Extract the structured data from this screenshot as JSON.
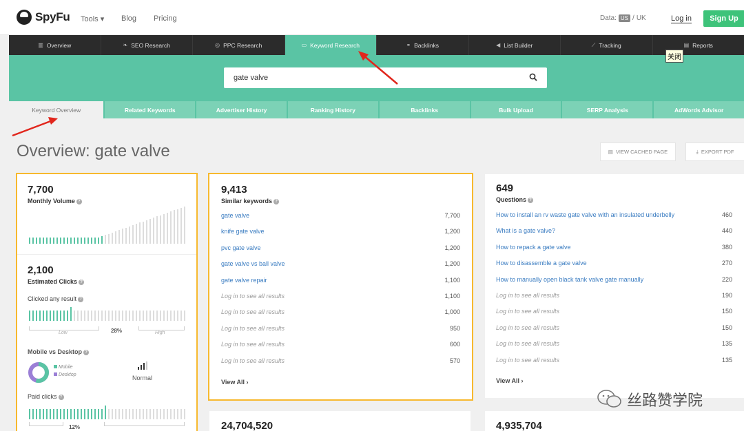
{
  "brand": {
    "name": "SpyFu"
  },
  "topnav": {
    "tools": "Tools ▾",
    "blog": "Blog",
    "pricing": "Pricing",
    "data_label": "Data:",
    "data_us": "US",
    "data_sep": "/",
    "data_uk": "UK",
    "login": "Log in",
    "signup": "Sign Up"
  },
  "mainnav": [
    {
      "label": "Overview",
      "icon": "bar-chart-icon",
      "glyph": "▥"
    },
    {
      "label": "SEO Research",
      "icon": "leaf-icon",
      "glyph": "❧"
    },
    {
      "label": "PPC Research",
      "icon": "target-icon",
      "glyph": "◎"
    },
    {
      "label": "Keyword Research",
      "icon": "keyboard-icon",
      "glyph": "▭"
    },
    {
      "label": "Backlinks",
      "icon": "link-icon",
      "glyph": "⚭"
    },
    {
      "label": "List Builder",
      "icon": "megaphone-icon",
      "glyph": "◀"
    },
    {
      "label": "Tracking",
      "icon": "line-chart-icon",
      "glyph": "⟋"
    },
    {
      "label": "Reports",
      "icon": "document-icon",
      "glyph": "▤"
    }
  ],
  "tooltip": "关闭",
  "search": {
    "value": "gate valve"
  },
  "subtabs": [
    "Keyword Overview",
    "Related Keywords",
    "Advertiser History",
    "Ranking History",
    "Backlinks",
    "Bulk Upload",
    "SERP Analysis",
    "AdWords Advisor"
  ],
  "page": {
    "title": "Overview: gate valve",
    "view_cached": "VIEW CACHED PAGE",
    "export_pdf": "EXPORT PDF"
  },
  "left": {
    "volume": "7,700",
    "volume_label": "Monthly Volume",
    "clicks": "2,100",
    "clicks_label": "Estimated Clicks",
    "clicked_any": "Clicked any result",
    "clicked_pct": "28%",
    "low": "Low",
    "high": "High",
    "mvd": "Mobile vs Desktop",
    "mobile": "Mobile",
    "desktop": "Desktop",
    "normal": "Normal",
    "paid": "Paid clicks",
    "paid_pct": "12%",
    "colors": {
      "mobile": "#5ac4a4",
      "desktop": "#9b7fd6"
    }
  },
  "similar": {
    "count": "9,413",
    "label": "Similar keywords",
    "view_all": "View All",
    "rows": [
      {
        "k": "gate valve",
        "v": "7,700"
      },
      {
        "k": "knife gate valve",
        "v": "1,200"
      },
      {
        "k": "pvc gate valve",
        "v": "1,200"
      },
      {
        "k": "gate valve vs ball valve",
        "v": "1,200"
      },
      {
        "k": "gate valve repair",
        "v": "1,100"
      },
      {
        "k": "Log in to see all results",
        "v": "1,100"
      },
      {
        "k": "Log in to see all results",
        "v": "1,000"
      },
      {
        "k": "Log in to see all results",
        "v": "950"
      },
      {
        "k": "Log in to see all results",
        "v": "600"
      },
      {
        "k": "Log in to see all results",
        "v": "570"
      }
    ]
  },
  "questions": {
    "count": "649",
    "label": "Questions",
    "view_all": "View All",
    "rows": [
      {
        "k": "How to install an rv waste gate valve with an insulated underbelly",
        "v": "460"
      },
      {
        "k": "What is a gate valve?",
        "v": "440"
      },
      {
        "k": "How to repack a gate valve",
        "v": "380"
      },
      {
        "k": "How to disassemble a gate valve",
        "v": "270"
      },
      {
        "k": "How to manually open black tank valve gate manually",
        "v": "220"
      },
      {
        "k": "Log in to see all results",
        "v": "190"
      },
      {
        "k": "Log in to see all results",
        "v": "150"
      },
      {
        "k": "Log in to see all results",
        "v": "150"
      },
      {
        "k": "Log in to see all results",
        "v": "135"
      },
      {
        "k": "Log in to see all results",
        "v": "135"
      }
    ]
  },
  "bottom": {
    "a": "24,704,520",
    "b": "4,935,704"
  },
  "watermark": "丝路赞学院",
  "accent": "#5ac4a4"
}
